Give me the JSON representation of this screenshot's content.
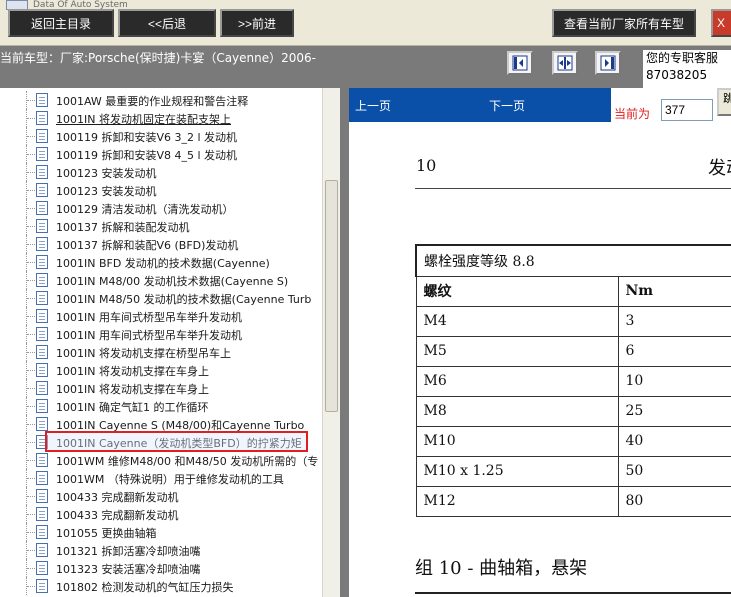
{
  "top_bar": {
    "logo_text": "Data Of Auto System",
    "back_main_label": "返回主目录",
    "prev_label": "<<后退",
    "next_label": ">>前进",
    "all_models_label": "查看当前厂家所有车型",
    "close_label": "X"
  },
  "info_bar": {
    "car_label": "当前车型：厂家:Porsche(保时捷)卡宴（Cayenne）2006-",
    "service_line1": "您的专职客服",
    "service_line2": "87038205"
  },
  "tree": {
    "items": [
      {
        "label": "1001AW 最重要的作业规程和警告注释",
        "underline": false
      },
      {
        "label": "1001IN 将发动机固定在装配支架上",
        "underline": true
      },
      {
        "label": "100119 拆卸和安装V6 3_2 l 发动机",
        "underline": false
      },
      {
        "label": "100119 拆卸和安装V8 4_5 l 发动机",
        "underline": false
      },
      {
        "label": "100123 安装发动机",
        "underline": false
      },
      {
        "label": "100123 安装发动机",
        "underline": false
      },
      {
        "label": "100129 清洁发动机（清洗发动机）",
        "underline": false
      },
      {
        "label": "100137 拆解和装配发动机",
        "underline": false
      },
      {
        "label": "100137 拆解和装配V6 (BFD)发动机",
        "underline": false
      },
      {
        "label": "1001IN BFD 发动机的技术数据(Cayenne)",
        "underline": false
      },
      {
        "label": "1001IN M48/00 发动机技术数据(Cayenne S)",
        "underline": false
      },
      {
        "label": "1001IN M48/50 发动机的技术数据(Cayenne Turb",
        "underline": false
      },
      {
        "label": "1001IN 用车间式桥型吊车举升发动机",
        "underline": false
      },
      {
        "label": "1001IN 用车间式桥型吊车举升发动机",
        "underline": false
      },
      {
        "label": "1001IN 将发动机支撑在桥型吊车上",
        "underline": false
      },
      {
        "label": "1001IN 将发动机支撑在车身上",
        "underline": false
      },
      {
        "label": "1001IN 将发动机支撑在车身上",
        "underline": false
      },
      {
        "label": "1001IN 确定气缸1 的工作循环",
        "underline": false
      },
      {
        "label": "1001IN Cayenne S (M48/00)和Cayenne Turbo",
        "underline": false
      },
      {
        "label": "1001IN Cayenne（发动机类型BFD）的拧紧力矩",
        "underline": false
      },
      {
        "label": "1001WM 维修M48/00 和M48/50 发动机所需的（专",
        "underline": false
      },
      {
        "label": "1001WM （特殊说明）用于维修发动机的工具",
        "underline": false
      },
      {
        "label": "100433 完成翻新发动机",
        "underline": false
      },
      {
        "label": "100433 完成翻新发动机",
        "underline": false
      },
      {
        "label": "101055 更换曲轴箱",
        "underline": false
      },
      {
        "label": "101321 拆卸活塞冷却喷油嘴",
        "underline": false
      },
      {
        "label": "101323 安装活塞冷却喷油嘴",
        "underline": false
      },
      {
        "label": "101802 检测发动机的气缸压力损失",
        "underline": false
      }
    ],
    "selected_index": 19
  },
  "doc_toolbar": {
    "prev_label": "上一页",
    "next_label": "下一页",
    "current_label": "当前为",
    "page_value": "377",
    "go_label": "跳"
  },
  "document": {
    "chapter_number": "10",
    "chapter_title": "发动",
    "table_caption": "螺栓强度等级 8.8",
    "table_headers": [
      "螺纹",
      "Nm"
    ],
    "table_rows": [
      [
        "M4",
        "3"
      ],
      [
        "M5",
        "6"
      ],
      [
        "M6",
        "10"
      ],
      [
        "M8",
        "25"
      ],
      [
        "M10",
        "40"
      ],
      [
        "M10 x 1.25",
        "50"
      ],
      [
        "M12",
        "80"
      ]
    ],
    "section_title": "组 10 - 曲轴箱，悬架"
  }
}
